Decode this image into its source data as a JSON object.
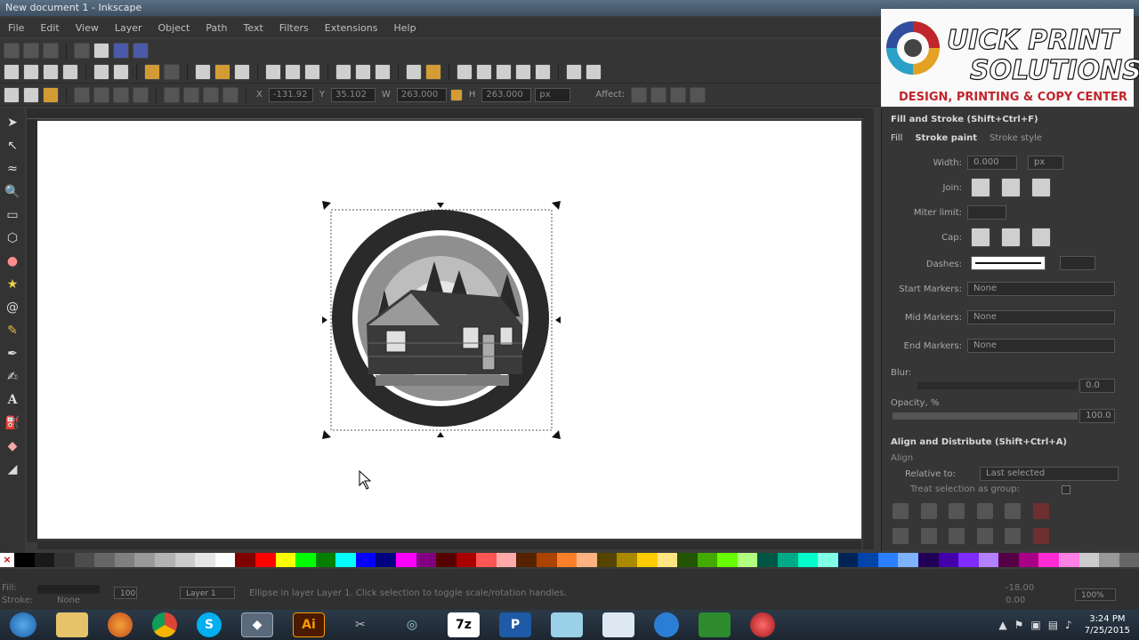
{
  "window": {
    "title": "New document 1 - Inkscape"
  },
  "menu": [
    "File",
    "Edit",
    "View",
    "Layer",
    "Object",
    "Path",
    "Text",
    "Filters",
    "Extensions",
    "Help"
  ],
  "toolbar_xywh": {
    "x_label": "X",
    "x_value": "-131.92",
    "y_label": "Y",
    "y_value": "35.102",
    "w_label": "W",
    "w_value": "263.000",
    "h_label": "H",
    "h_value": "263.000",
    "unit": "px",
    "affect_label": "Affect:"
  },
  "fill_stroke": {
    "title": "Fill and Stroke (Shift+Ctrl+F)",
    "tabs": [
      "Fill",
      "Stroke paint",
      "Stroke style"
    ],
    "width_label": "Width:",
    "width_value": "0.000",
    "width_unit": "px",
    "join_label": "Join:",
    "miter_label": "Miter limit:",
    "cap_label": "Cap:",
    "dashes_label": "Dashes:",
    "start_markers_label": "Start Markers:",
    "start_markers_value": "None",
    "mid_markers_label": "Mid Markers:",
    "mid_markers_value": "None",
    "end_markers_label": "End Markers:",
    "end_markers_value": "None",
    "blur_label": "Blur:",
    "blur_value": "0.0",
    "opacity_label": "Opacity, %",
    "opacity_value": "100.0"
  },
  "align": {
    "title": "Align and Distribute (Shift+Ctrl+A)",
    "section": "Align",
    "relative_label": "Relative to:",
    "relative_value": "Last selected",
    "treat_group_label": "Treat selection as group:"
  },
  "status": {
    "fill_label": "Fill:",
    "stroke_label": "Stroke:",
    "stroke_value": "None",
    "opacity_value": "100",
    "layer": "Layer 1",
    "message": "Ellipse in layer Layer 1. Click selection to toggle scale/rotation handles.",
    "x_coord": "-18.00",
    "y_coord": "0.00",
    "zoom": "100%"
  },
  "logo": {
    "line1": "UICK PRINT",
    "line2": "SOLUTIONS",
    "tagline": "DESIGN, PRINTING & COPY CENTER"
  },
  "clock": {
    "time": "3:24 PM",
    "date": "7/25/2015"
  },
  "taskbar_labels": {
    "illustrator": "Ai",
    "sevenzip": "7z",
    "publisher": "P"
  },
  "colors": {
    "accent": "#d49b35",
    "panel_bg": "#363636",
    "canvas_bg": "#ffffff",
    "logo_red": "#c0262c"
  },
  "palette": [
    "#000000",
    "#1a1a1a",
    "#333333",
    "#4d4d4d",
    "#666666",
    "#808080",
    "#999999",
    "#b3b3b3",
    "#cccccc",
    "#e6e6e6",
    "#ffffff",
    "#800000",
    "#ff0000",
    "#ffff00",
    "#00ff00",
    "#008000",
    "#00ffff",
    "#0000ff",
    "#000080",
    "#ff00ff",
    "#800080",
    "#550000",
    "#aa0000",
    "#ff5555",
    "#ffaaaa",
    "#552200",
    "#aa4400",
    "#ff7f2a",
    "#ffb380",
    "#554400",
    "#aa8800",
    "#ffcc00",
    "#ffe680",
    "#225500",
    "#44aa00",
    "#66ff00",
    "#b3ff80",
    "#005544",
    "#00aa88",
    "#00ffcc",
    "#80ffe6",
    "#002255",
    "#0044aa",
    "#2a7fff",
    "#80b3ff",
    "#220055",
    "#4400aa",
    "#7f2aff",
    "#b380ff",
    "#550044",
    "#aa0088",
    "#ff2ad4",
    "#ff80e5",
    "#cccccc",
    "#999999",
    "#666666"
  ]
}
